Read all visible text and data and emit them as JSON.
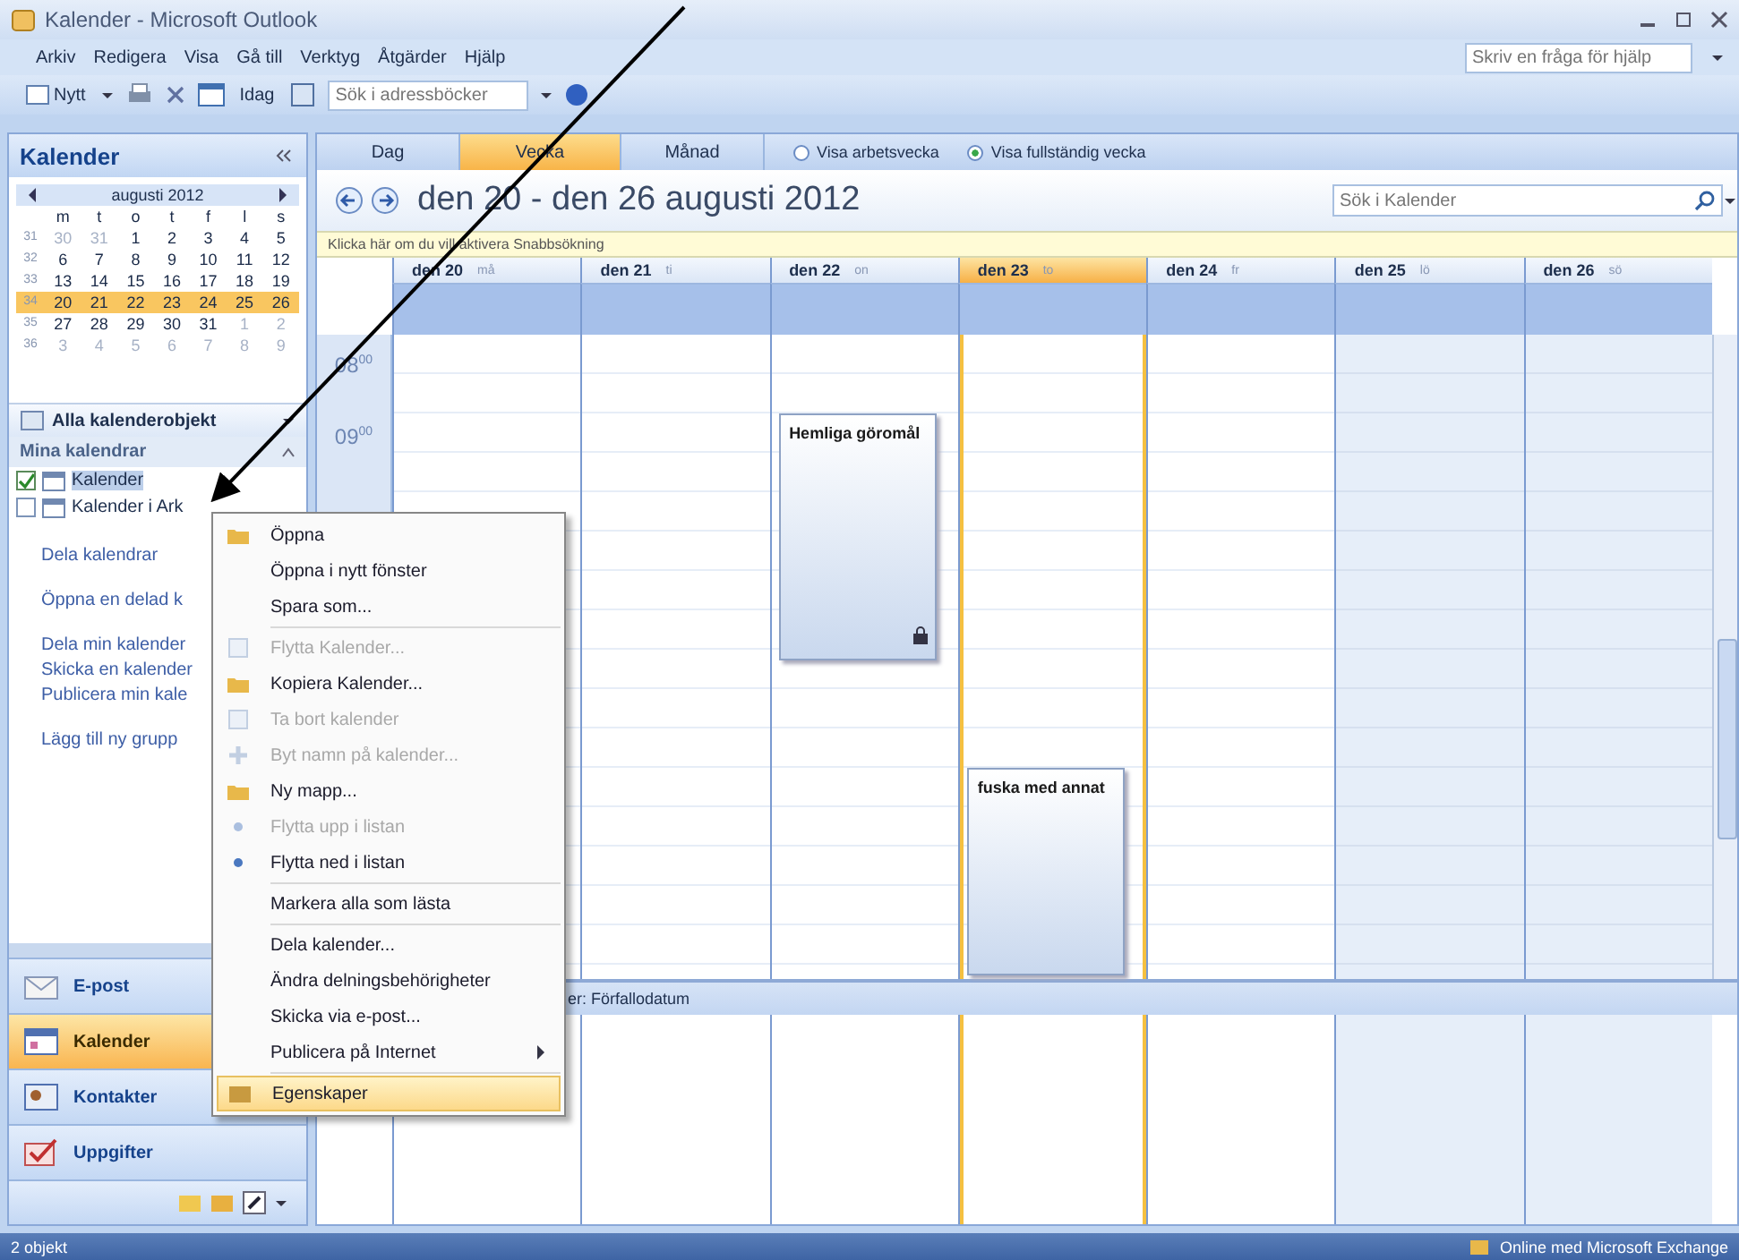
{
  "window": {
    "title": "Kalender - Microsoft Outlook"
  },
  "menu": [
    "Arkiv",
    "Redigera",
    "Visa",
    "Gå till",
    "Verktyg",
    "Åtgärder",
    "Hjälp"
  ],
  "help_search": {
    "placeholder": "Skriv en fråga för hjälp"
  },
  "toolbar": {
    "new_label": "Nytt",
    "today_label": "Idag",
    "address_search": {
      "placeholder": "Sök i adressböcker"
    }
  },
  "sidebar": {
    "title": "Kalender",
    "mini_calendar": {
      "month": "augusti 2012",
      "weekdays": [
        "m",
        "t",
        "o",
        "t",
        "f",
        "l",
        "s"
      ],
      "weeks": [
        {
          "number": "31",
          "selected": false,
          "days": [
            {
              "d": "30",
              "muted": true
            },
            {
              "d": "31",
              "muted": true
            },
            {
              "d": "1",
              "muted": false
            },
            {
              "d": "2",
              "muted": false
            },
            {
              "d": "3",
              "muted": false
            },
            {
              "d": "4",
              "muted": false
            },
            {
              "d": "5",
              "muted": false
            }
          ]
        },
        {
          "number": "32",
          "selected": false,
          "days": [
            {
              "d": "6",
              "muted": false
            },
            {
              "d": "7",
              "muted": false
            },
            {
              "d": "8",
              "muted": false
            },
            {
              "d": "9",
              "muted": false
            },
            {
              "d": "10",
              "muted": false
            },
            {
              "d": "11",
              "muted": false
            },
            {
              "d": "12",
              "muted": false
            }
          ]
        },
        {
          "number": "33",
          "selected": false,
          "days": [
            {
              "d": "13",
              "muted": false
            },
            {
              "d": "14",
              "muted": false
            },
            {
              "d": "15",
              "muted": false
            },
            {
              "d": "16",
              "muted": false
            },
            {
              "d": "17",
              "muted": false
            },
            {
              "d": "18",
              "muted": false
            },
            {
              "d": "19",
              "muted": false
            }
          ]
        },
        {
          "number": "34",
          "selected": true,
          "days": [
            {
              "d": "20",
              "muted": false
            },
            {
              "d": "21",
              "muted": false
            },
            {
              "d": "22",
              "muted": false
            },
            {
              "d": "23",
              "muted": false
            },
            {
              "d": "24",
              "muted": false
            },
            {
              "d": "25",
              "muted": false
            },
            {
              "d": "26",
              "muted": false
            }
          ]
        },
        {
          "number": "35",
          "selected": false,
          "days": [
            {
              "d": "27",
              "muted": false
            },
            {
              "d": "28",
              "muted": false
            },
            {
              "d": "29",
              "muted": false
            },
            {
              "d": "30",
              "muted": false
            },
            {
              "d": "31",
              "muted": false
            },
            {
              "d": "1",
              "muted": true
            },
            {
              "d": "2",
              "muted": true
            }
          ]
        },
        {
          "number": "36",
          "selected": false,
          "days": [
            {
              "d": "3",
              "muted": true
            },
            {
              "d": "4",
              "muted": true
            },
            {
              "d": "5",
              "muted": true
            },
            {
              "d": "6",
              "muted": true
            },
            {
              "d": "7",
              "muted": true
            },
            {
              "d": "8",
              "muted": true
            },
            {
              "d": "9",
              "muted": true
            }
          ]
        }
      ]
    },
    "filter": "Alla kalenderobjekt",
    "group": "Mina kalendrar",
    "calendars": [
      {
        "label": "Kalender",
        "checked": true,
        "selected": true
      },
      {
        "label": "Kalender i Ark",
        "checked": false,
        "selected": false
      }
    ],
    "link_groups": [
      [
        "Dela kalendrar"
      ],
      [
        "Öppna en delad k"
      ],
      [
        "Dela min kalender",
        "Skicka en kalender",
        "Publicera min kale"
      ],
      [
        "Lägg till ny grupp"
      ]
    ],
    "nav": [
      {
        "label": "E-post",
        "kind": "mail",
        "selected": false
      },
      {
        "label": "Kalender",
        "kind": "calendar",
        "selected": true
      },
      {
        "label": "Kontakter",
        "kind": "contacts",
        "selected": false
      },
      {
        "label": "Uppgifter",
        "kind": "tasks",
        "selected": false
      }
    ]
  },
  "views": [
    {
      "label": "Dag",
      "selected": false
    },
    {
      "label": "Vecka",
      "selected": true
    },
    {
      "label": "Månad",
      "selected": false
    }
  ],
  "week_options": [
    {
      "label": "Visa arbetsvecka",
      "selected": false
    },
    {
      "label": "Visa fullständig vecka",
      "selected": true
    }
  ],
  "range_title": "den 20 - den 26 augusti 2012",
  "calendar_search": {
    "placeholder": "Sök i Kalender"
  },
  "quick_search_bar": "Klicka här om du vill aktivera Snabbsökning",
  "days": [
    {
      "label": "den 20",
      "weekday": "må",
      "today": false,
      "weekend": false
    },
    {
      "label": "den 21",
      "weekday": "ti",
      "today": false,
      "weekend": false
    },
    {
      "label": "den 22",
      "weekday": "on",
      "today": false,
      "weekend": false,
      "events": [
        {
          "title": "Hemliga göromål",
          "private": true
        }
      ]
    },
    {
      "label": "den 23",
      "weekday": "to",
      "today": true,
      "weekend": false,
      "events": [
        {
          "title": "fuska med annat",
          "private": false
        }
      ]
    },
    {
      "label": "den 24",
      "weekday": "fr",
      "today": false,
      "weekend": false
    },
    {
      "label": "den 25",
      "weekday": "lö",
      "today": false,
      "weekend": true
    },
    {
      "label": "den 26",
      "weekday": "sö",
      "today": false,
      "weekend": true
    }
  ],
  "times": [
    "08$^{00}$",
    "09$^{00}$"
  ],
  "tasks_bar": "er: Förfallodatum",
  "context_menu": [
    [
      {
        "label": "Öppna",
        "disabled": false,
        "submenu": false,
        "selected": false
      },
      {
        "label": "Öppna i nytt fönster",
        "disabled": false,
        "submenu": false,
        "selected": false
      },
      {
        "label": "Spara som...",
        "disabled": false,
        "submenu": false,
        "selected": false
      }
    ],
    [
      {
        "label": "Flytta Kalender...",
        "disabled": true,
        "submenu": false,
        "selected": false
      },
      {
        "label": "Kopiera Kalender...",
        "disabled": false,
        "submenu": false,
        "selected": false
      },
      {
        "label": "Ta bort kalender",
        "disabled": true,
        "submenu": false,
        "selected": false
      },
      {
        "label": "Byt namn på kalender...",
        "disabled": true,
        "submenu": false,
        "selected": false
      },
      {
        "label": "Ny mapp...",
        "disabled": false,
        "submenu": false,
        "selected": false
      },
      {
        "label": "Flytta upp i listan",
        "disabled": true,
        "submenu": false,
        "selected": false
      },
      {
        "label": "Flytta ned i listan",
        "disabled": false,
        "submenu": false,
        "selected": false
      }
    ],
    [
      {
        "label": "Markera alla som lästa",
        "disabled": false,
        "submenu": false,
        "selected": false
      }
    ],
    [
      {
        "label": "Dela kalender...",
        "disabled": false,
        "submenu": false,
        "selected": false
      },
      {
        "label": "Ändra delningsbehörigheter",
        "disabled": false,
        "submenu": false,
        "selected": false
      },
      {
        "label": "Skicka via e-post...",
        "disabled": false,
        "submenu": false,
        "selected": false
      },
      {
        "label": "Publicera på Internet",
        "disabled": false,
        "submenu": true,
        "selected": false
      }
    ],
    [
      {
        "label": "Egenskaper",
        "disabled": false,
        "submenu": false,
        "selected": true
      }
    ]
  ],
  "status_bar": {
    "left": "2 objekt",
    "right": "Online med Microsoft Exchange"
  }
}
